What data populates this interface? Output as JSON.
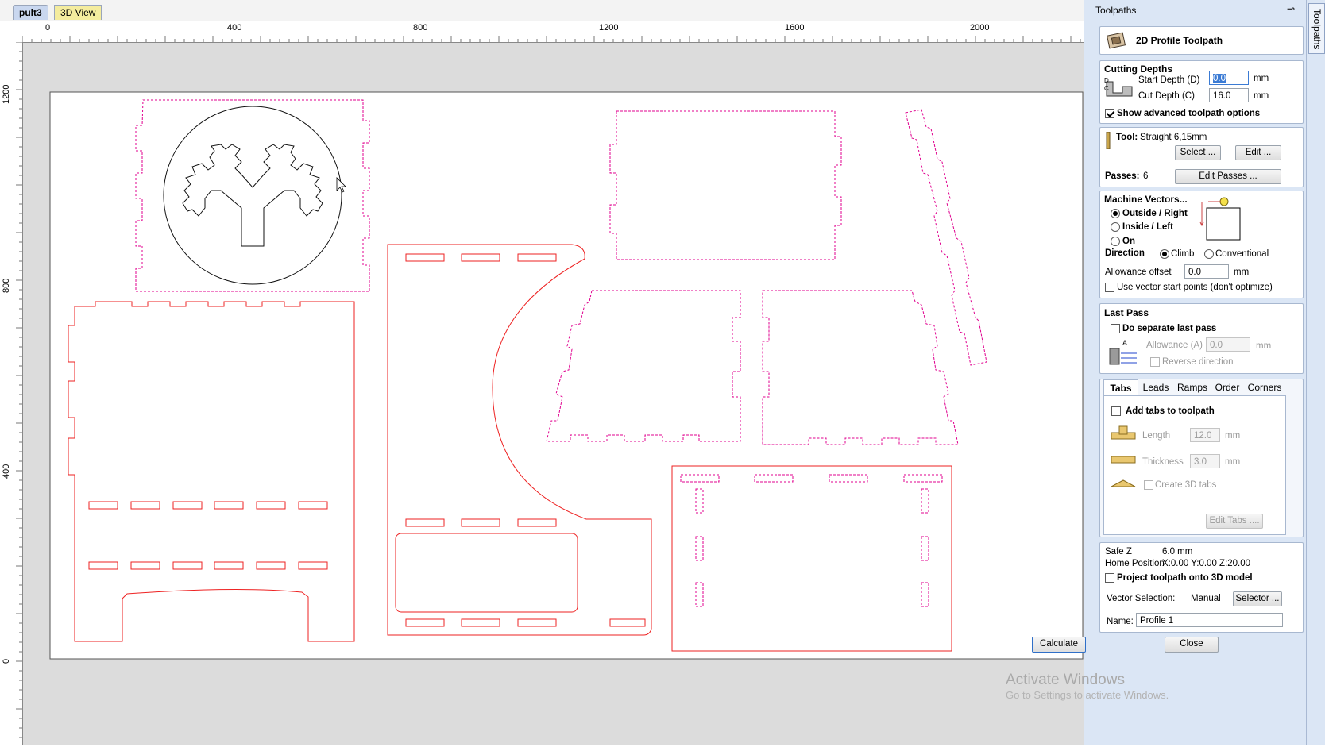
{
  "doc_tabs": [
    "pult3",
    "3D View"
  ],
  "ruler": {
    "top_labels": [
      "0",
      "400",
      "800",
      "1200",
      "1600",
      "2000"
    ],
    "left_labels": [
      "1200",
      "800",
      "400",
      "0"
    ]
  },
  "panel": {
    "header": "Toolpaths",
    "pin_glyph": "⊸",
    "strip_tab": "Toolpaths",
    "toolpath_title": "2D Profile Toolpath",
    "cutting_depths": {
      "title": "Cutting Depths",
      "start_label": "Start Depth (D)",
      "start_value": "0.0",
      "cut_label": "Cut Depth (C)",
      "cut_value": "16.0",
      "unit": "mm",
      "advanced_label": "Show advanced toolpath options",
      "diagram_d": "D",
      "diagram_c": "C"
    },
    "tool": {
      "label": "Tool:",
      "value": "Straight  6,15mm",
      "select_btn": "Select ...",
      "edit_btn": "Edit ...",
      "passes_label": "Passes:",
      "passes_value": "6",
      "edit_passes_btn": "Edit Passes ..."
    },
    "machine": {
      "title": "Machine Vectors...",
      "options": [
        "Outside / Right",
        "Inside / Left",
        "On"
      ],
      "selected": 0,
      "direction_label": "Direction",
      "direction_options": [
        "Climb",
        "Conventional"
      ],
      "direction_selected": 0,
      "allowance_label": "Allowance offset",
      "allowance_value": "0.0",
      "unit": "mm",
      "vector_start_label": "Use vector start points (don't optimize)"
    },
    "last_pass": {
      "title": "Last Pass",
      "separate_label": "Do separate last pass",
      "allowance_label": "Allowance (A)",
      "allowance_value": "0.0",
      "unit": "mm",
      "reverse_label": "Reverse direction",
      "diagram_a": "A"
    },
    "subtabs": [
      "Tabs",
      "Leads",
      "Ramps",
      "Order",
      "Corners"
    ],
    "tabs": {
      "add_label": "Add tabs to toolpath",
      "length_label": "Length",
      "length_value": "12.0",
      "thickness_label": "Thickness",
      "thickness_value": "3.0",
      "unit": "mm",
      "create3d_label": "Create 3D tabs",
      "edit_tabs_btn": "Edit Tabs ...."
    },
    "safe": {
      "safe_z_label": "Safe Z",
      "safe_z_value": "6.0 mm",
      "home_label": "Home Position",
      "home_value": "X:0.00 Y:0.00 Z:20.00",
      "project_label": "Project toolpath onto 3D model",
      "vector_sel_label": "Vector Selection:",
      "vector_sel_value": "Manual",
      "selector_btn": "Selector ...",
      "name_label": "Name:",
      "name_value": "Profile 1"
    },
    "calculate_btn": "Calculate",
    "close_btn": "Close"
  },
  "watermark": {
    "title": "Activate Windows",
    "subtitle": "Go to Settings to activate Windows."
  },
  "colors": {
    "vector_selected": "#e0008f",
    "vector_red": "#ee2222",
    "vector_black": "#111111",
    "panel_bg": "#dbe6f5"
  }
}
